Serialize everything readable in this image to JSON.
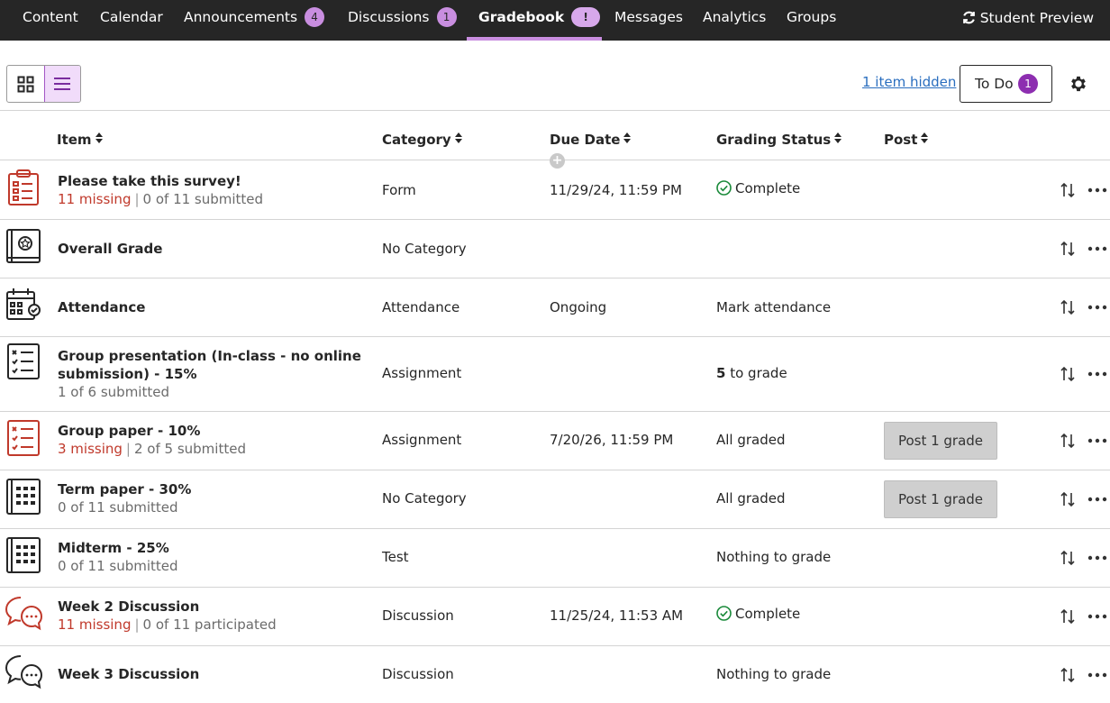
{
  "nav": {
    "tabs": [
      {
        "label": "Content"
      },
      {
        "label": "Calendar"
      },
      {
        "label": "Announcements",
        "count": "4"
      },
      {
        "label": "Discussions",
        "count": "1"
      },
      {
        "label": "Gradebook",
        "count": "!"
      },
      {
        "label": "Messages"
      },
      {
        "label": "Analytics"
      },
      {
        "label": "Groups"
      }
    ],
    "active_tab": "Gradebook",
    "student_preview": "Student Preview"
  },
  "toolbar": {
    "hidden_link": "1 item hidden",
    "todo_label": "To Do",
    "todo_count": "1",
    "view_mode": "list"
  },
  "columns": {
    "item": "Item",
    "category": "Category",
    "due_date": "Due Date",
    "grading_status": "Grading Status",
    "post": "Post"
  },
  "add_column_symbol": "+",
  "colors": {
    "nav_bg": "#262626",
    "accent": "#c98ee0",
    "missing": "#c0392b",
    "complete_green": "#1a8a3a",
    "link": "#2a6ebf"
  },
  "rows": [
    {
      "icon": "survey-icon",
      "title": "Please take this survey!",
      "missing": "11 missing",
      "submitted": "0 of 11 submitted",
      "category": "Form",
      "due": "11/29/24, 11:59 PM",
      "status": "Complete",
      "status_type": "complete",
      "post": ""
    },
    {
      "icon": "overall-grade-icon",
      "title": "Overall Grade",
      "missing": "",
      "submitted": "",
      "category": "No Category",
      "due": "",
      "status": "",
      "status_type": "",
      "post": ""
    },
    {
      "icon": "attendance-calendar-icon",
      "title": "Attendance",
      "missing": "",
      "submitted": "",
      "category": "Attendance",
      "due": "Ongoing",
      "status": "Mark attendance",
      "status_type": "text",
      "post": ""
    },
    {
      "icon": "assignment-checklist-icon",
      "title_line1": "Group presentation (In-class - no online",
      "title_line2": "submission) - 15%",
      "missing": "",
      "submitted": "1 of 6 submitted",
      "category": "Assignment",
      "due": "",
      "status_count": "5",
      "status": "to grade",
      "status_type": "to-grade",
      "post": ""
    },
    {
      "icon": "assignment-checklist-icon",
      "title": "Group paper - 10%",
      "missing": "3 missing",
      "submitted": "2 of 5 submitted",
      "category": "Assignment",
      "due": "7/20/26, 11:59 PM",
      "status": "All graded",
      "status_type": "text",
      "post": "Post 1 grade"
    },
    {
      "icon": "test-grid-icon",
      "title": "Term paper - 30%",
      "missing": "",
      "submitted": "0 of 11 submitted",
      "category": "No Category",
      "due": "",
      "status": "All graded",
      "status_type": "text",
      "post": "Post 1 grade"
    },
    {
      "icon": "test-grid-icon",
      "title": "Midterm - 25%",
      "missing": "",
      "submitted": "0 of 11 submitted",
      "category": "Test",
      "due": "",
      "status": "Nothing to grade",
      "status_type": "text",
      "post": ""
    },
    {
      "icon": "discussion-bubbles-icon",
      "title": "Week 2 Discussion",
      "missing": "11 missing",
      "submitted": "0 of 11 participated",
      "category": "Discussion",
      "due": "11/25/24, 11:53 AM",
      "status": "Complete",
      "status_type": "complete",
      "post": ""
    },
    {
      "icon": "discussion-bubbles-icon",
      "title": "Week 3 Discussion",
      "missing": "",
      "submitted": "",
      "category": "Discussion",
      "due": "",
      "status": "Nothing to grade",
      "status_type": "text",
      "post": ""
    }
  ]
}
